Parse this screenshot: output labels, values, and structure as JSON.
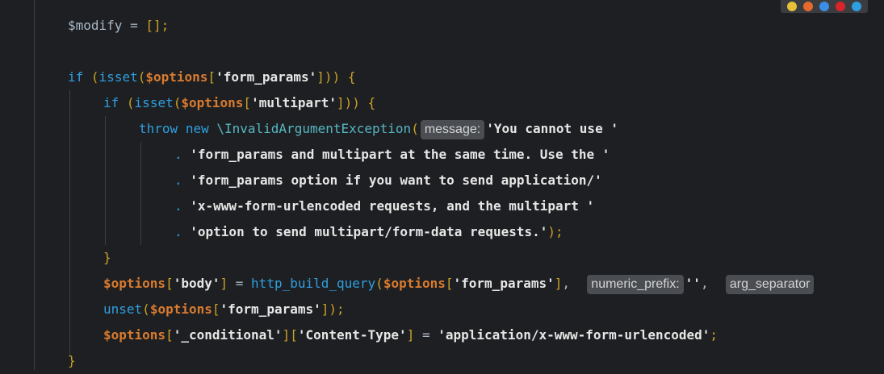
{
  "lines": [
    {
      "tokens": [
        [
          "punc",
          "$modify"
        ],
        [
          "punc",
          " = "
        ],
        [
          "pun",
          "[]"
        ],
        [
          "pun",
          ";"
        ]
      ]
    },
    {
      "tokens": []
    },
    {
      "tokens": [
        [
          "kw",
          "if"
        ],
        [
          "punc",
          " "
        ],
        [
          "pun",
          "("
        ],
        [
          "kw",
          "isset"
        ],
        [
          "pun",
          "("
        ],
        [
          "var",
          "$options"
        ],
        [
          "pun",
          "["
        ],
        [
          "str",
          "'form_params'"
        ],
        [
          "pun",
          "])"
        ],
        [
          "pun",
          ")"
        ],
        [
          "punc",
          " "
        ],
        [
          "pun",
          "{"
        ]
      ]
    },
    {
      "tokens": [
        [
          "kw",
          "if"
        ],
        [
          "punc",
          " "
        ],
        [
          "pun",
          "("
        ],
        [
          "kw",
          "isset"
        ],
        [
          "pun",
          "("
        ],
        [
          "var",
          "$options"
        ],
        [
          "pun",
          "["
        ],
        [
          "str",
          "'multipart'"
        ],
        [
          "pun",
          "])"
        ],
        [
          "pun",
          ")"
        ],
        [
          "punc",
          " "
        ],
        [
          "pun",
          "{"
        ]
      ]
    },
    {
      "tokens": [
        [
          "kw",
          "throw"
        ],
        [
          "punc",
          " "
        ],
        [
          "kw",
          "new"
        ],
        [
          "punc",
          " "
        ],
        [
          "cls",
          "\\InvalidArgumentException"
        ],
        [
          "pun",
          "("
        ],
        [
          "hint",
          "message:"
        ],
        [
          "str",
          "'You cannot use '"
        ]
      ]
    },
    {
      "tokens": [
        [
          "concat",
          ". "
        ],
        [
          "str",
          "'form_params and multipart at the same time. Use the '"
        ]
      ]
    },
    {
      "tokens": [
        [
          "concat",
          ". "
        ],
        [
          "str",
          "'form_params option if you want to send application/'"
        ]
      ]
    },
    {
      "tokens": [
        [
          "concat",
          ". "
        ],
        [
          "str",
          "'x-www-form-urlencoded requests, and the multipart '"
        ]
      ]
    },
    {
      "tokens": [
        [
          "concat",
          ". "
        ],
        [
          "str",
          "'option to send multipart/form-data requests.'"
        ],
        [
          "pun",
          ");"
        ]
      ]
    },
    {
      "tokens": [
        [
          "pun",
          "}"
        ]
      ]
    },
    {
      "tokens": [
        [
          "var",
          "$options"
        ],
        [
          "pun",
          "["
        ],
        [
          "str",
          "'body'"
        ],
        [
          "pun",
          "]"
        ],
        [
          "punc",
          " = "
        ],
        [
          "fn",
          "http_build_query"
        ],
        [
          "pun",
          "("
        ],
        [
          "var",
          "$options"
        ],
        [
          "pun",
          "["
        ],
        [
          "str",
          "'form_params'"
        ],
        [
          "pun",
          "]"
        ],
        [
          "punc",
          ",  "
        ],
        [
          "hint",
          "numeric_prefix:"
        ],
        [
          "str",
          "''"
        ],
        [
          "punc",
          ",  "
        ],
        [
          "hint",
          "arg_separator"
        ]
      ]
    },
    {
      "tokens": [
        [
          "kw",
          "unset"
        ],
        [
          "pun",
          "("
        ],
        [
          "var",
          "$options"
        ],
        [
          "pun",
          "["
        ],
        [
          "str",
          "'form_params'"
        ],
        [
          "pun",
          "])"
        ],
        [
          "pun",
          ";"
        ]
      ]
    },
    {
      "tokens": [
        [
          "var",
          "$options"
        ],
        [
          "pun",
          "["
        ],
        [
          "str",
          "'_conditional'"
        ],
        [
          "pun",
          "]["
        ],
        [
          "str",
          "'Content-Type'"
        ],
        [
          "pun",
          "]"
        ],
        [
          "punc",
          " = "
        ],
        [
          "str",
          "'application/x-www-form-urlencoded'"
        ],
        [
          "pun",
          ";"
        ]
      ]
    },
    {
      "tokens": [
        [
          "pun",
          "}"
        ]
      ]
    }
  ],
  "browser_icons": [
    "chrome-icon",
    "firefox-icon",
    "safari-icon",
    "opera-icon",
    "edge-icon"
  ],
  "colors": {
    "chrome": "#e8c13a",
    "firefox": "#e66a2c",
    "safari": "#3a8ee6",
    "opera": "#d9242b",
    "edge": "#2f9fe0"
  }
}
